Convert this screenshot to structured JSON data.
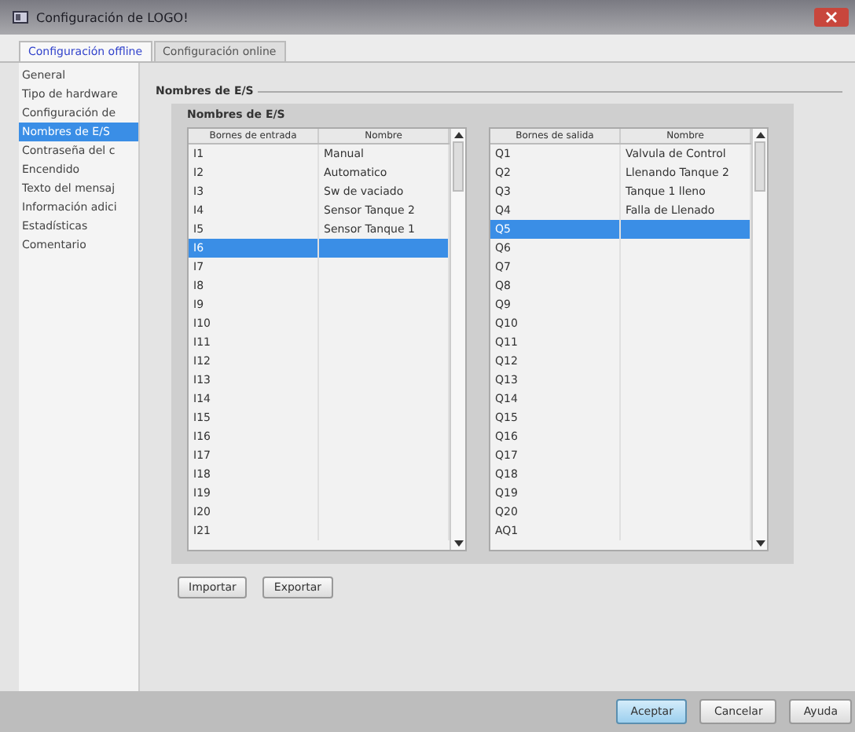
{
  "window": {
    "title": "Configuración de LOGO!"
  },
  "tabs": [
    {
      "label": "Configuración offline",
      "selected": true
    },
    {
      "label": "Configuración online",
      "selected": false
    }
  ],
  "sidebar": {
    "items": [
      {
        "label": "General",
        "selected": false
      },
      {
        "label": "Tipo de hardware",
        "selected": false
      },
      {
        "label": "Configuración de",
        "selected": false
      },
      {
        "label": "Nombres de E/S",
        "selected": true
      },
      {
        "label": "Contraseña del c",
        "selected": false
      },
      {
        "label": "Encendido",
        "selected": false
      },
      {
        "label": "Texto del mensaj",
        "selected": false
      },
      {
        "label": "Información adici",
        "selected": false
      },
      {
        "label": "Estadísticas",
        "selected": false
      },
      {
        "label": "Comentario",
        "selected": false
      }
    ]
  },
  "section_title": "Nombres de E/S",
  "group_title": "Nombres de E/S",
  "tables": [
    {
      "columns": [
        "Bornes de entrada",
        "Nombre"
      ],
      "rows": [
        {
          "cells": [
            "I1",
            "Manual"
          ],
          "selected": false
        },
        {
          "cells": [
            "I2",
            "Automatico"
          ],
          "selected": false
        },
        {
          "cells": [
            "I3",
            "Sw de vaciado"
          ],
          "selected": false
        },
        {
          "cells": [
            "I4",
            "Sensor Tanque 2"
          ],
          "selected": false
        },
        {
          "cells": [
            "I5",
            "Sensor Tanque 1"
          ],
          "selected": false
        },
        {
          "cells": [
            "I6",
            ""
          ],
          "selected": true
        },
        {
          "cells": [
            "I7",
            ""
          ],
          "selected": false
        },
        {
          "cells": [
            "I8",
            ""
          ],
          "selected": false
        },
        {
          "cells": [
            "I9",
            ""
          ],
          "selected": false
        },
        {
          "cells": [
            "I10",
            ""
          ],
          "selected": false
        },
        {
          "cells": [
            "I11",
            ""
          ],
          "selected": false
        },
        {
          "cells": [
            "I12",
            ""
          ],
          "selected": false
        },
        {
          "cells": [
            "I13",
            ""
          ],
          "selected": false
        },
        {
          "cells": [
            "I14",
            ""
          ],
          "selected": false
        },
        {
          "cells": [
            "I15",
            ""
          ],
          "selected": false
        },
        {
          "cells": [
            "I16",
            ""
          ],
          "selected": false
        },
        {
          "cells": [
            "I17",
            ""
          ],
          "selected": false
        },
        {
          "cells": [
            "I18",
            ""
          ],
          "selected": false
        },
        {
          "cells": [
            "I19",
            ""
          ],
          "selected": false
        },
        {
          "cells": [
            "I20",
            ""
          ],
          "selected": false
        },
        {
          "cells": [
            "I21",
            ""
          ],
          "selected": false
        }
      ]
    },
    {
      "columns": [
        "Bornes de salida",
        "Nombre"
      ],
      "rows": [
        {
          "cells": [
            "Q1",
            "Valvula de Control"
          ],
          "selected": false
        },
        {
          "cells": [
            "Q2",
            "Llenando Tanque 2"
          ],
          "selected": false
        },
        {
          "cells": [
            "Q3",
            "Tanque 1 lleno"
          ],
          "selected": false
        },
        {
          "cells": [
            "Q4",
            "Falla de Llenado"
          ],
          "selected": false
        },
        {
          "cells": [
            "Q5",
            ""
          ],
          "selected": true
        },
        {
          "cells": [
            "Q6",
            ""
          ],
          "selected": false
        },
        {
          "cells": [
            "Q7",
            ""
          ],
          "selected": false
        },
        {
          "cells": [
            "Q8",
            ""
          ],
          "selected": false
        },
        {
          "cells": [
            "Q9",
            ""
          ],
          "selected": false
        },
        {
          "cells": [
            "Q10",
            ""
          ],
          "selected": false
        },
        {
          "cells": [
            "Q11",
            ""
          ],
          "selected": false
        },
        {
          "cells": [
            "Q12",
            ""
          ],
          "selected": false
        },
        {
          "cells": [
            "Q13",
            ""
          ],
          "selected": false
        },
        {
          "cells": [
            "Q14",
            ""
          ],
          "selected": false
        },
        {
          "cells": [
            "Q15",
            ""
          ],
          "selected": false
        },
        {
          "cells": [
            "Q16",
            ""
          ],
          "selected": false
        },
        {
          "cells": [
            "Q17",
            ""
          ],
          "selected": false
        },
        {
          "cells": [
            "Q18",
            ""
          ],
          "selected": false
        },
        {
          "cells": [
            "Q19",
            ""
          ],
          "selected": false
        },
        {
          "cells": [
            "Q20",
            ""
          ],
          "selected": false
        },
        {
          "cells": [
            "AQ1",
            ""
          ],
          "selected": false
        }
      ]
    }
  ],
  "actions": [
    "Importar",
    "Exportar"
  ],
  "buttons": [
    {
      "label": "Aceptar",
      "kind": "default"
    },
    {
      "label": "Cancelar",
      "kind": "normal"
    },
    {
      "label": "Ayuda",
      "kind": "normal"
    }
  ]
}
